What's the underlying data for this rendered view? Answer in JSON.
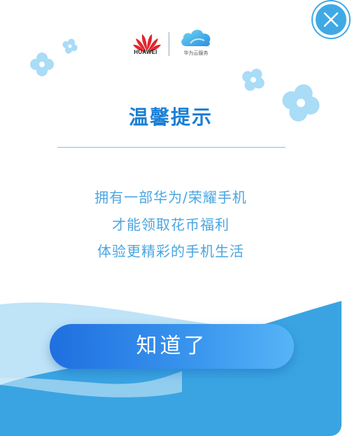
{
  "brand": {
    "huawei_label": "HUAWEI",
    "cloud_label": "华为云服务"
  },
  "dialog": {
    "title": "温馨提示",
    "message_lines": [
      "拥有一部华为/荣耀手机",
      "才能领取花币福利",
      "体验更精彩的手机生活"
    ],
    "confirm_label": "知道了"
  },
  "colors": {
    "accent": "#1a7fd6",
    "message": "#4aa6e0",
    "button_start": "#1f6fe0",
    "button_end": "#56b4f6",
    "wave_light": "#bfe3f7",
    "wave_dark": "#3aa4e2",
    "flower": "#a9dcf6",
    "close": "#3fa9e6"
  },
  "icons": {
    "close": "close-icon",
    "huawei": "huawei-logo-icon",
    "cloud": "cloud-service-logo-icon",
    "flower": "flower-decoration-icon"
  }
}
